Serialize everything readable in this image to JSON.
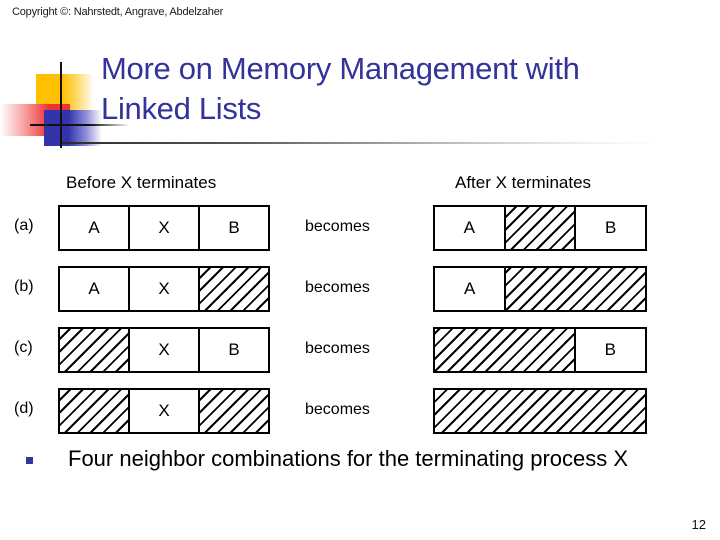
{
  "copyright": "Copyright ©: Nahrstedt, Angrave, Abdelzaher",
  "title": "More on Memory Management with Linked Lists",
  "diagram": {
    "headers": {
      "before": "Before X terminates",
      "after": "After X terminates"
    },
    "transition_label": "becomes",
    "rows": [
      {
        "label": "(a)",
        "before": [
          {
            "text": "A",
            "hatched": false,
            "span": 1
          },
          {
            "text": "X",
            "hatched": false,
            "span": 1
          },
          {
            "text": "B",
            "hatched": false,
            "span": 1
          }
        ],
        "after": [
          {
            "text": "A",
            "hatched": false,
            "span": 1
          },
          {
            "text": "",
            "hatched": true,
            "span": 1
          },
          {
            "text": "B",
            "hatched": false,
            "span": 1
          }
        ]
      },
      {
        "label": "(b)",
        "before": [
          {
            "text": "A",
            "hatched": false,
            "span": 1
          },
          {
            "text": "X",
            "hatched": false,
            "span": 1
          },
          {
            "text": "",
            "hatched": true,
            "span": 1
          }
        ],
        "after": [
          {
            "text": "A",
            "hatched": false,
            "span": 1
          },
          {
            "text": "",
            "hatched": true,
            "span": 2
          }
        ]
      },
      {
        "label": "(c)",
        "before": [
          {
            "text": "",
            "hatched": true,
            "span": 1
          },
          {
            "text": "X",
            "hatched": false,
            "span": 1
          },
          {
            "text": "B",
            "hatched": false,
            "span": 1
          }
        ],
        "after": [
          {
            "text": "",
            "hatched": true,
            "span": 2
          },
          {
            "text": "B",
            "hatched": false,
            "span": 1
          }
        ]
      },
      {
        "label": "(d)",
        "before": [
          {
            "text": "",
            "hatched": true,
            "span": 1
          },
          {
            "text": "X",
            "hatched": false,
            "span": 1
          },
          {
            "text": "",
            "hatched": true,
            "span": 1
          }
        ],
        "after": [
          {
            "text": "",
            "hatched": true,
            "span": 3
          }
        ]
      }
    ]
  },
  "bullet": {
    "text": "Four neighbor combinations for the terminating process X"
  },
  "page_number": "12",
  "colors": {
    "title": "#333399",
    "bullet_marker": "#333399",
    "logo_yellow": "#ffc000",
    "logo_red": "#ee3333",
    "logo_blue": "#3333aa"
  }
}
